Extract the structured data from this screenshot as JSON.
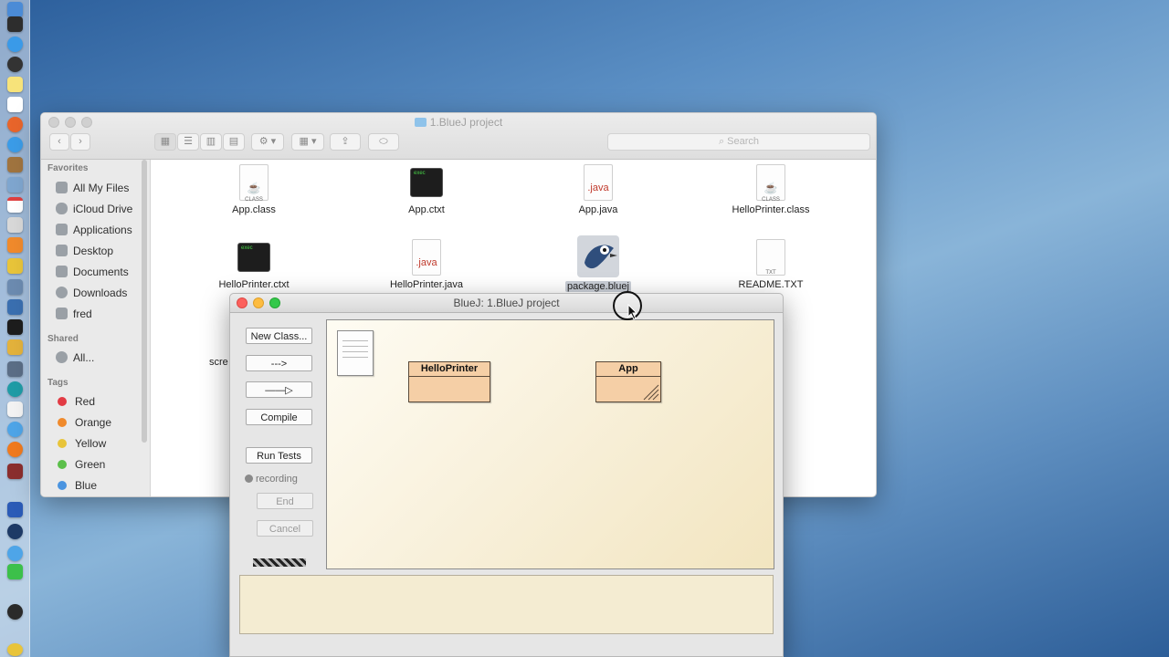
{
  "finder": {
    "title": "1.BlueJ project",
    "search_placeholder": "Search",
    "sidebar": {
      "favorites_heading": "Favorites",
      "favorites": [
        "All My Files",
        "iCloud Drive",
        "Applications",
        "Desktop",
        "Documents",
        "Downloads",
        "fred"
      ],
      "shared_heading": "Shared",
      "shared": [
        "All..."
      ],
      "tags_heading": "Tags",
      "tags": [
        {
          "label": "Red",
          "color": "#e23b44"
        },
        {
          "label": "Orange",
          "color": "#f08a2c"
        },
        {
          "label": "Yellow",
          "color": "#e8c43a"
        },
        {
          "label": "Green",
          "color": "#5bbf4a"
        },
        {
          "label": "Blue",
          "color": "#4a94e0"
        }
      ]
    },
    "files": [
      {
        "label": "App.class",
        "icon": "class-file-icon",
        "badge": "CLASS"
      },
      {
        "label": "App.ctxt",
        "icon": "exec-file-icon",
        "badge": "exec"
      },
      {
        "label": "App.java",
        "icon": "java-file-icon",
        "badge": ".java"
      },
      {
        "label": "HelloPrinter.class",
        "icon": "class-file-icon",
        "badge": "CLASS"
      },
      {
        "label": "HelloPrinter.ctxt",
        "icon": "exec-file-icon",
        "badge": "exec"
      },
      {
        "label": "HelloPrinter.java",
        "icon": "java-file-icon",
        "badge": ".java"
      },
      {
        "label": "package.bluej",
        "icon": "bluej-bird-icon",
        "badge": ""
      },
      {
        "label": "README.TXT",
        "icon": "text-file-icon",
        "badge": "TXT"
      }
    ],
    "partial_label": "scre"
  },
  "bluej": {
    "title": "BlueJ:  1.BlueJ project",
    "buttons": {
      "new_class": "New Class...",
      "dependency_arrow": "--->",
      "inheritance_arrow": "——▷",
      "compile": "Compile",
      "run_tests": "Run Tests",
      "recording": "recording",
      "end": "End",
      "cancel": "Cancel"
    },
    "classes": [
      {
        "name": "HelloPrinter"
      },
      {
        "name": "App"
      }
    ]
  },
  "colors": {
    "class_fill": "#f5cfa6",
    "accent_red": "#fc615d",
    "accent_yellow": "#fdbc40",
    "accent_green": "#34c84a"
  }
}
